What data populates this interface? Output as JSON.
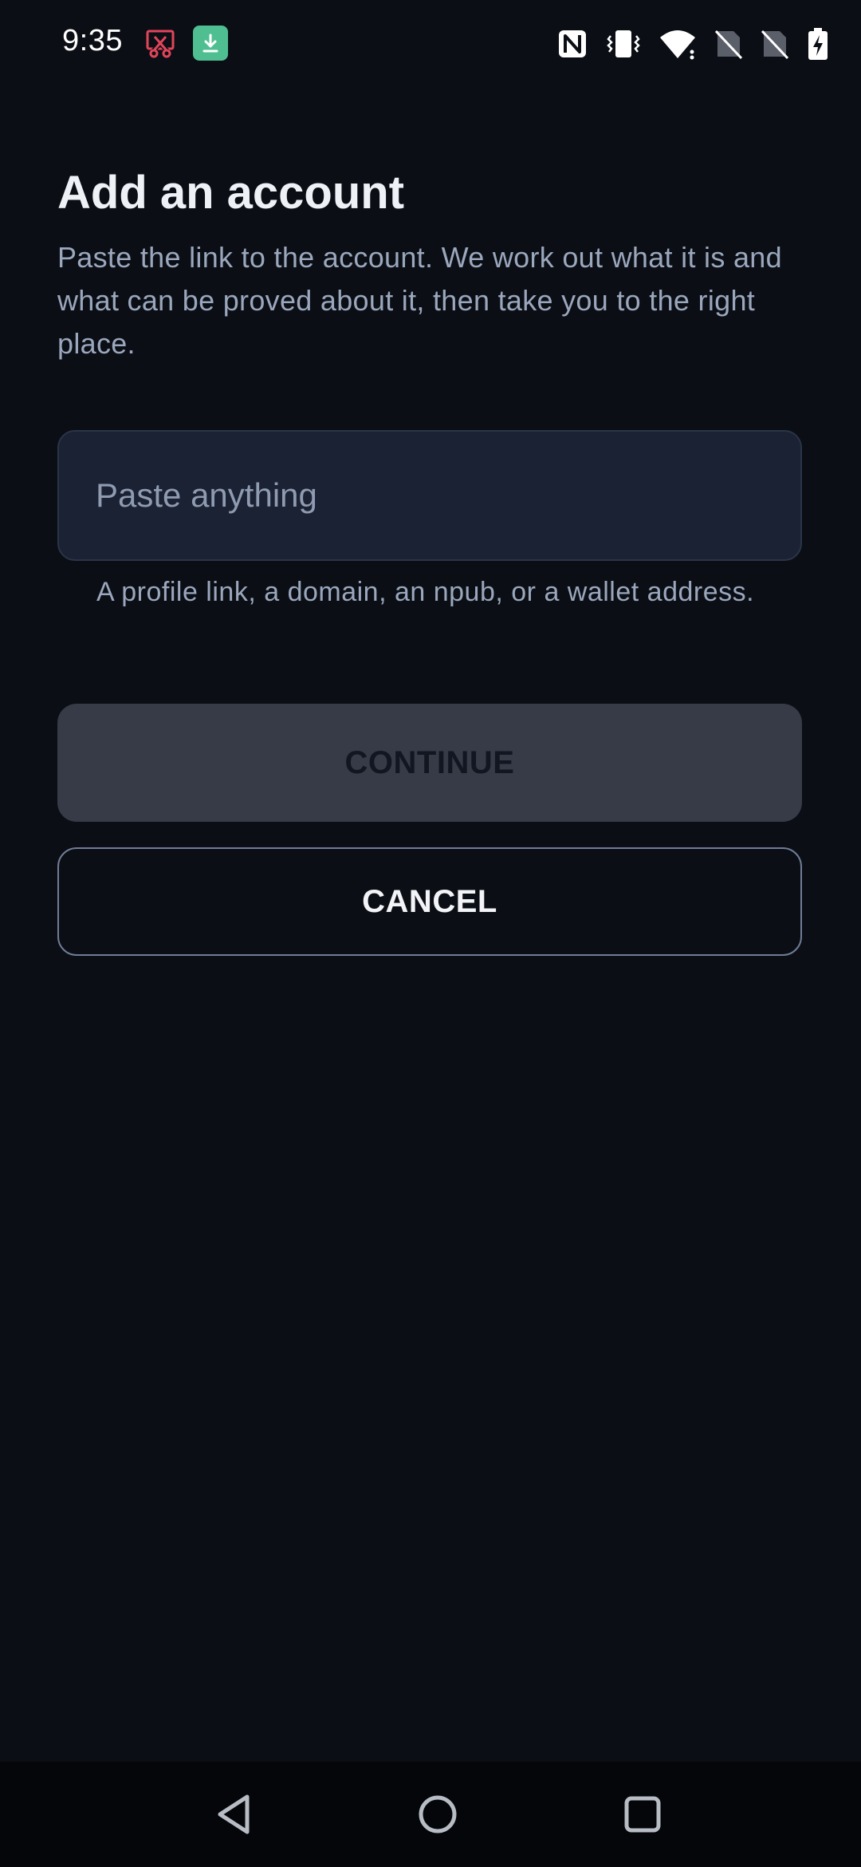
{
  "status_bar": {
    "time": "9:35",
    "notification_icons": [
      "screenshot-cut-icon",
      "download-icon"
    ],
    "system_icons": [
      "nfc-icon",
      "vibrate-icon",
      "wifi-icon",
      "no-sim-icon",
      "no-sim-icon",
      "battery-charging-icon"
    ]
  },
  "page": {
    "title": "Add an account",
    "description": "Paste the link to the account. We work out what it is and what can be proved about it, then take you to the right place."
  },
  "input": {
    "value": "",
    "placeholder": "Paste anything",
    "helper": "A profile link, a domain, an npub, or a wallet address."
  },
  "buttons": {
    "continue_label": "CONTINUE",
    "cancel_label": "CANCEL"
  },
  "nav_bar": {
    "icons": [
      "back-icon",
      "home-icon",
      "recents-icon"
    ]
  },
  "colors": {
    "background": "#0b0e14",
    "input_background": "#1a2233",
    "disabled_button": "#363b47",
    "outline": "#6f7d96",
    "download_badge": "#4fbf91",
    "cut_icon": "#e0455a"
  }
}
